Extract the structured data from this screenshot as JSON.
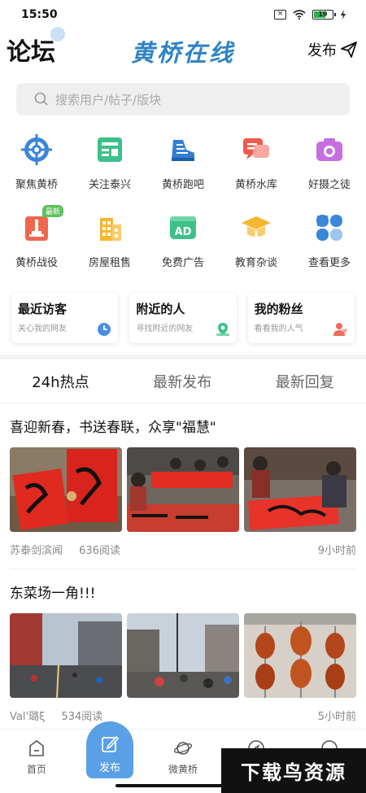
{
  "status": {
    "time": "15:50",
    "battery": "19"
  },
  "header": {
    "title": "论坛",
    "brand": "黄桥在线",
    "publish_label": "发布"
  },
  "search": {
    "placeholder": "搜索用户/帖子/版块"
  },
  "grid": {
    "items": [
      {
        "label": "聚焦黄桥",
        "icon": "target-icon"
      },
      {
        "label": "关注泰兴",
        "icon": "news-icon"
      },
      {
        "label": "黄桥跑吧",
        "icon": "shoe-icon"
      },
      {
        "label": "黄桥水库",
        "icon": "chat-icon"
      },
      {
        "label": "好摄之徒",
        "icon": "camera-icon"
      },
      {
        "label": "黄桥战役",
        "icon": "monument-icon",
        "badge": "最新"
      },
      {
        "label": "房屋租售",
        "icon": "building-icon"
      },
      {
        "label": "免费广告",
        "icon": "ad-icon"
      },
      {
        "label": "教育杂谈",
        "icon": "graduation-icon"
      },
      {
        "label": "查看更多",
        "icon": "more-icon"
      }
    ]
  },
  "cards": [
    {
      "title": "最近访客",
      "sub": "关心我的网友"
    },
    {
      "title": "附近的人",
      "sub": "寻找附近的网友"
    },
    {
      "title": "我的粉丝",
      "sub": "看看我的人气"
    }
  ],
  "tabs": [
    {
      "label": "24h热点"
    },
    {
      "label": "最新发布"
    },
    {
      "label": "最新回复"
    }
  ],
  "posts": [
    {
      "title": "喜迎新春，书送春联，众享\"福慧\"",
      "author": "苏泰剑滨闻",
      "reads": "636阅读",
      "time": "9小时前"
    },
    {
      "title": "东菜场一角!!!",
      "author": "Val'璐ξ",
      "reads": "534阅读",
      "time": "5小时前"
    }
  ],
  "bottom_nav": {
    "home": "首页",
    "publish": "发布",
    "weihuangqiao": "微黄桥"
  },
  "watermark": "下载鸟资源",
  "colors": {
    "accent": "#5aa0e6",
    "brand": "#2f83c6",
    "badge": "#5ec25c"
  }
}
